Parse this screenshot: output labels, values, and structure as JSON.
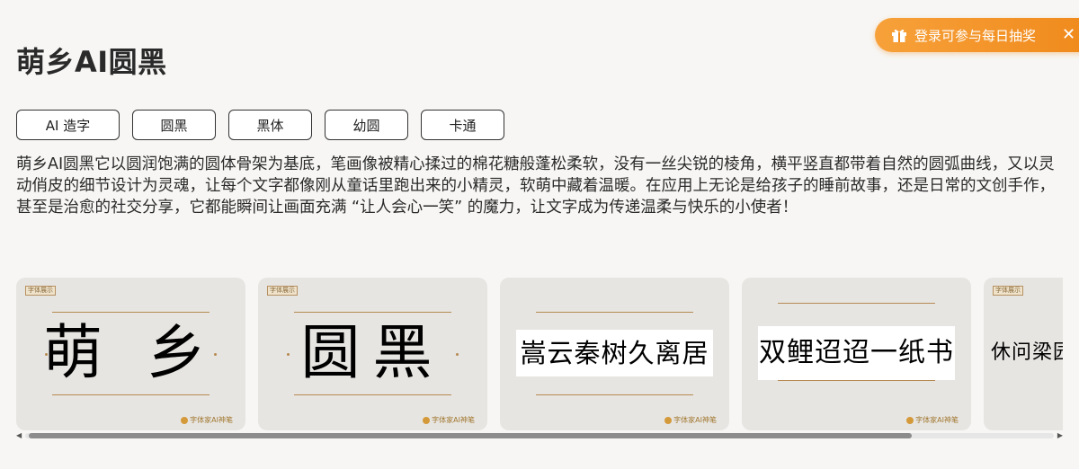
{
  "promo": {
    "text": "登录可参与每日抽奖",
    "gift_icon": "gift-icon",
    "close_icon": "close-icon",
    "color": "#f08a1c"
  },
  "page": {
    "title": "萌乡AI圆黑"
  },
  "tags": [
    "AI 造字",
    "圆黑",
    "黑体",
    "幼圆",
    "卡通"
  ],
  "description": "萌乡AI圆黑它以圆润饱满的圆体骨架为基底，笔画像被精心揉过的棉花糖般蓬松柔软，没有一丝尖锐的棱角，横平竖直都带着自然的圆弧曲线，又以灵动俏皮的细节设计为灵魂，让每个文字都像刚从童话里跑出来的小精灵，软萌中藏着温暖。在应用上无论是给孩子的睡前故事，还是日常的文创手作，甚至是治愈的社交分享，它都能瞬间让画面充满 “让人会心一笑” 的魔力，让文字成为传递温柔与快乐的小使者！",
  "gallery": {
    "cards": [
      {
        "badge": "字体展示",
        "sample": "萌 乡",
        "style": "big",
        "brand": "字体家AI神笔"
      },
      {
        "badge": "字体展示",
        "sample": "圆黑",
        "style": "big",
        "brand": "字体家AI神笔"
      },
      {
        "badge": "",
        "sample": "嵩云秦树久离居",
        "style": "boxed",
        "brand": "字体家AI神笔"
      },
      {
        "badge": "",
        "sample": "双鲤迢迢一纸书",
        "style": "boxed",
        "brand": "字体家AI神笔"
      },
      {
        "badge": "字体展示",
        "sample": "休问梁园旧",
        "style": "boxed",
        "brand": ""
      }
    ]
  }
}
